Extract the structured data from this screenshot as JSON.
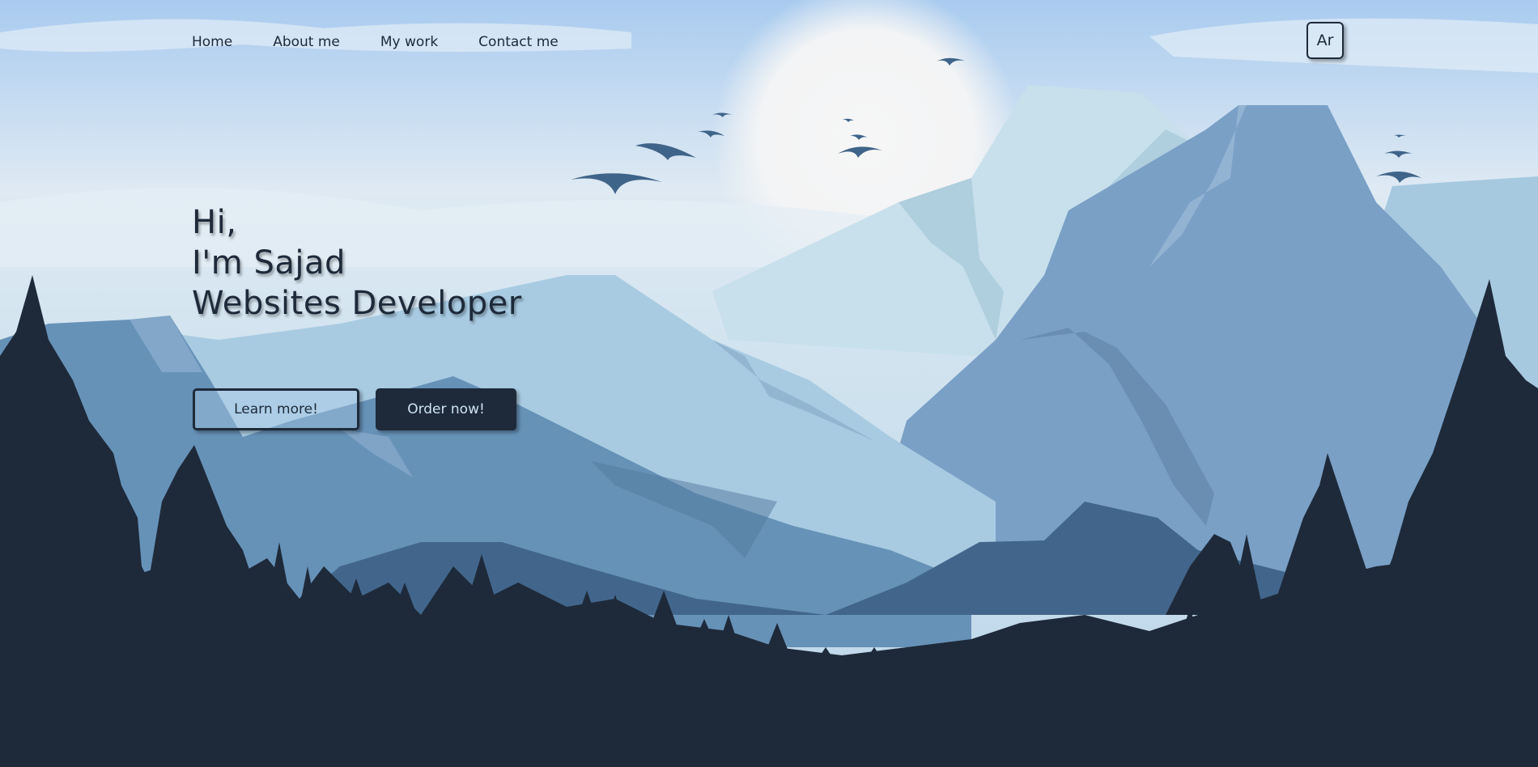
{
  "nav": {
    "items": [
      {
        "label": "Home"
      },
      {
        "label": "About me"
      },
      {
        "label": "My work"
      },
      {
        "label": "Contact me"
      }
    ],
    "lang_label": "Ar"
  },
  "hero": {
    "line1": "Hi,",
    "line2": "I'm Sajad",
    "line3": "Websites Developer",
    "learn_label": "Learn more!",
    "order_label": "Order now!"
  },
  "colors": {
    "dark": "#1e2a3a",
    "sky": "#bcd6ea",
    "accent_text": "#cfe3f3"
  }
}
